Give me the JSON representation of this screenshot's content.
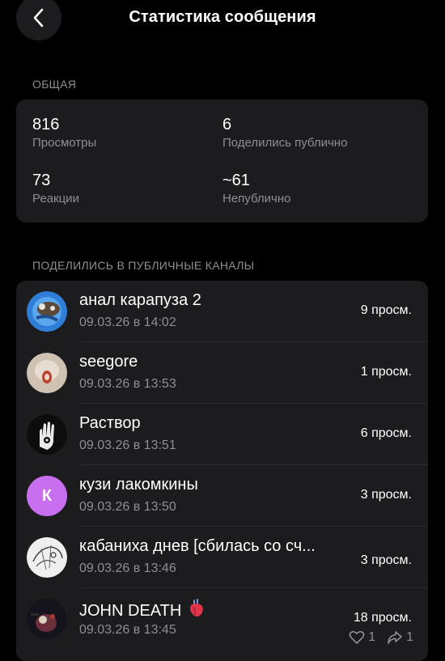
{
  "header": {
    "title": "Статистика сообщения"
  },
  "overview": {
    "section_label": "ОБЩАЯ",
    "stats": [
      {
        "value": "816",
        "label": "Просмотры"
      },
      {
        "value": "6",
        "label": "Поделились публично"
      },
      {
        "value": "73",
        "label": "Реакции"
      },
      {
        "value": "~61",
        "label": "Непублично"
      }
    ]
  },
  "shares": {
    "section_label": "ПОДЕЛИЛИСЬ В ПУБЛИЧНЫЕ КАНАЛЫ",
    "items": [
      {
        "name": "анал карапуза 2",
        "date": "09.03.26 в 14:02",
        "views": "9 просм."
      },
      {
        "name": "seegore",
        "date": "09.03.26 в 13:53",
        "views": "1 просм."
      },
      {
        "name": "Раствор",
        "date": "09.03.26 в 13:51",
        "views": "6 просм."
      },
      {
        "name": "кузи лакомкины",
        "date": "09.03.26 в 13:50",
        "views": "3 просм.",
        "avatar_letter": "К",
        "avatar_color": "#c86ff0"
      },
      {
        "name": "кабаниха днев [сбилась со сч...",
        "date": "09.03.26 в 13:46",
        "views": "3 просм."
      },
      {
        "name": "JOHN DEATH",
        "date": "09.03.26 в 13:45",
        "views": "18 просм.",
        "likes": "1",
        "reposts": "1"
      }
    ]
  }
}
